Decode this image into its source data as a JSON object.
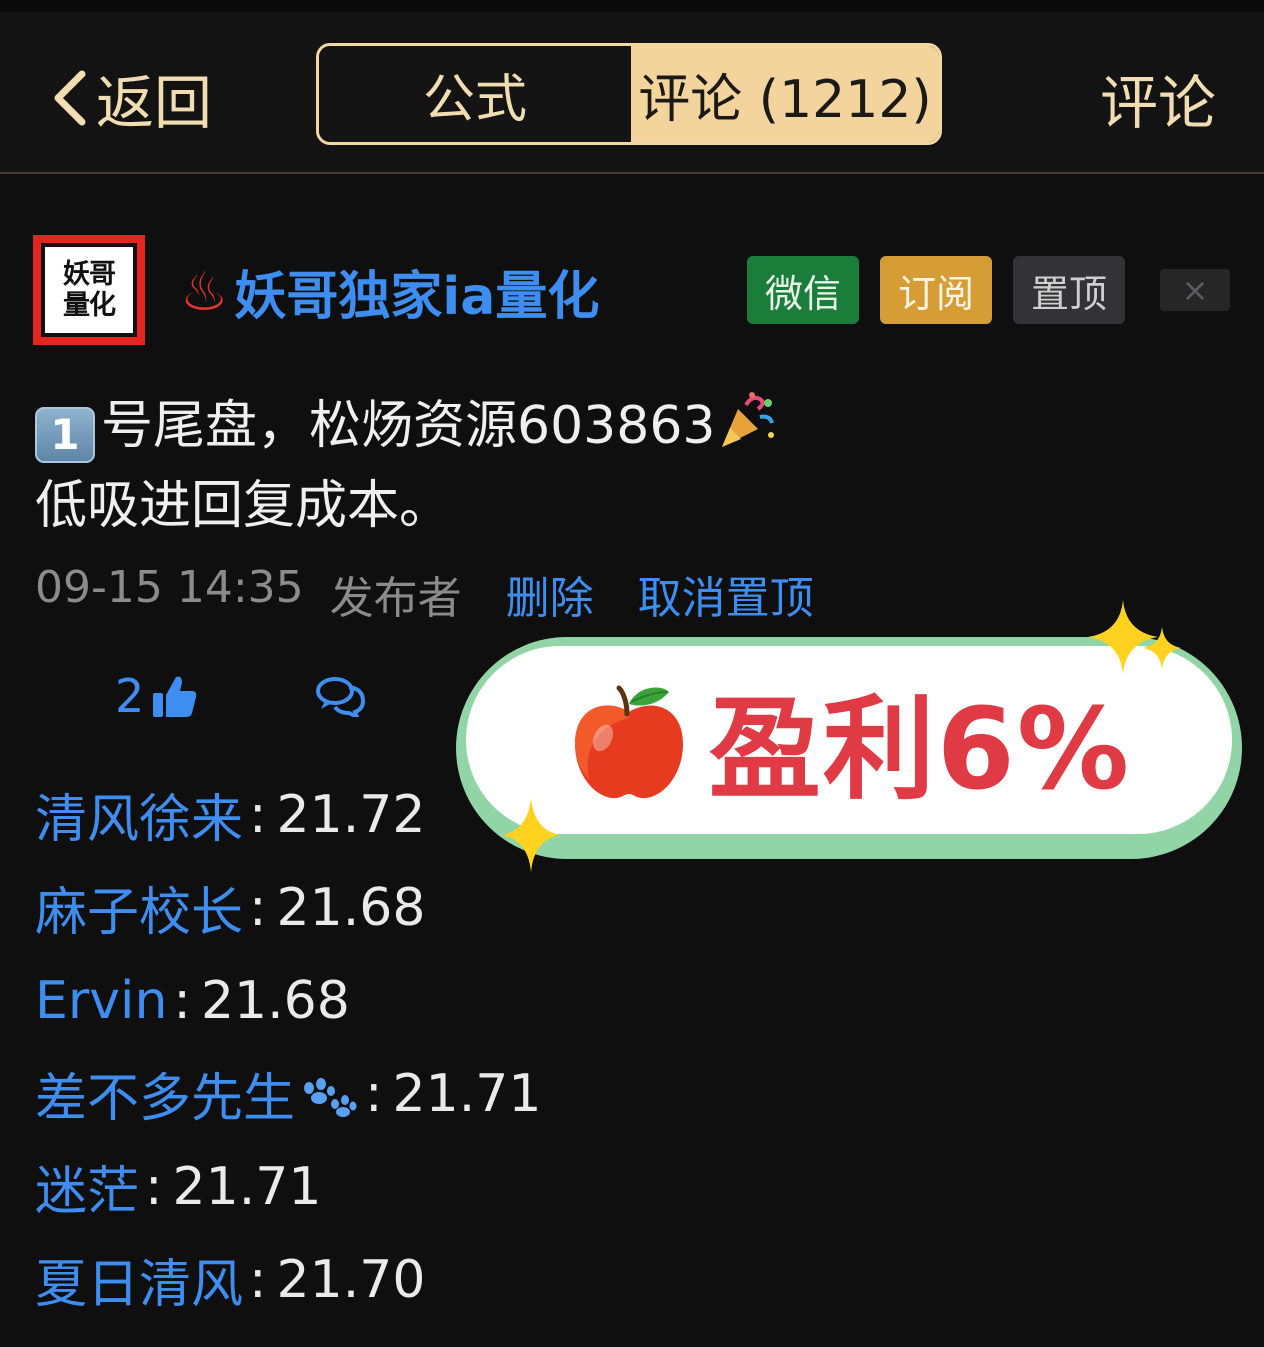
{
  "header": {
    "back_label": "返回",
    "tabs": [
      {
        "label": "公式",
        "active": false
      },
      {
        "label": "评论 (1212)",
        "active": true
      }
    ],
    "right_label": "评论"
  },
  "post": {
    "avatar_text": "妖哥量化",
    "username": "妖哥独家ia量化",
    "badges": {
      "wechat": "微信",
      "subscribe": "订阅",
      "pin": "置顶",
      "close": "×"
    },
    "number_emoji": "1",
    "line1": "号尾盘，松炀资源603863",
    "line2": "低吸进回复成本。",
    "datetime": "09-15 14:35",
    "publisher_label": "发布者",
    "delete_label": "删除",
    "unpin_label": "取消置顶",
    "like_count": "2"
  },
  "comments": [
    {
      "name": "清风徐来",
      "value": "21.72"
    },
    {
      "name": "麻子校长",
      "value": "21.68"
    },
    {
      "name": "Ervin",
      "value": "21.68"
    },
    {
      "name": "差不多先生",
      "value": "21.71"
    },
    {
      "name": "迷茫",
      "value": "21.71"
    },
    {
      "name": "夏日清风",
      "value": "21.70"
    }
  ],
  "overlay": {
    "profit_text": "盈利6%"
  },
  "colors": {
    "accent_gold": "#f3d49d",
    "link_blue": "#3d8ef0",
    "wechat_green": "#1a7d3a",
    "subscribe_gold": "#d69d36",
    "profit_red": "#e03a45"
  }
}
